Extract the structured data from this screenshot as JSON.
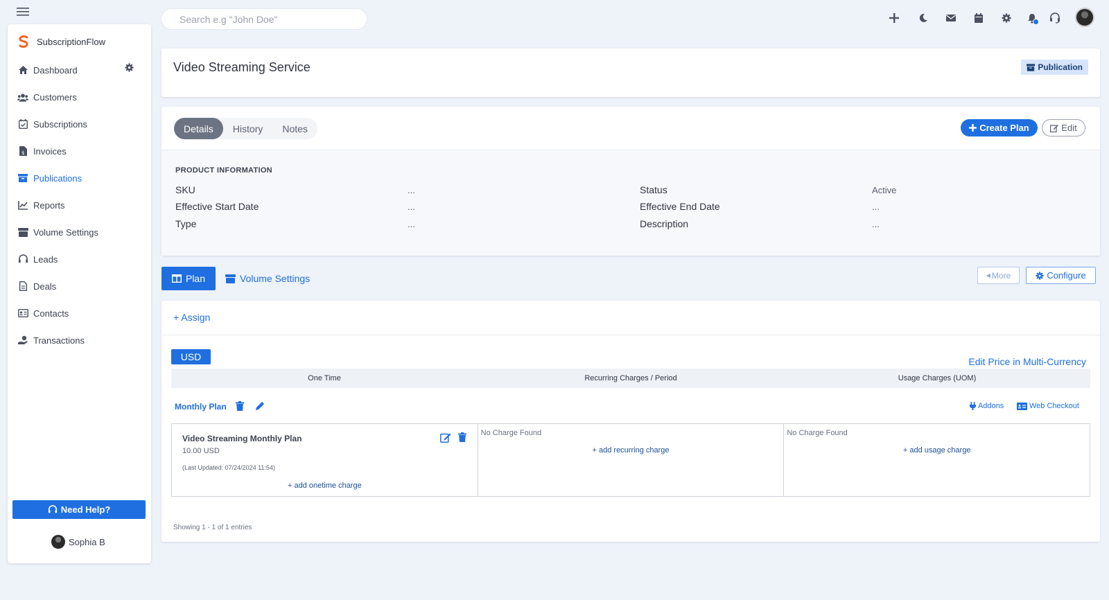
{
  "search": {
    "placeholder": "Search e.g \"John Doe\""
  },
  "brand": {
    "name": "SubscriptionFlow"
  },
  "sidebar": {
    "items": [
      {
        "label": "Dashboard",
        "icon": "home-icon"
      },
      {
        "label": "Customers",
        "icon": "users-icon"
      },
      {
        "label": "Subscriptions",
        "icon": "calendar-check-icon"
      },
      {
        "label": "Invoices",
        "icon": "invoice-icon"
      },
      {
        "label": "Publications",
        "icon": "archive-icon"
      },
      {
        "label": "Reports",
        "icon": "chart-line-icon"
      },
      {
        "label": "Volume Settings",
        "icon": "box-icon"
      },
      {
        "label": "Leads",
        "icon": "headset-icon"
      },
      {
        "label": "Deals",
        "icon": "document-icon"
      },
      {
        "label": "Contacts",
        "icon": "id-card-icon"
      },
      {
        "label": "Transactions",
        "icon": "hand-coin-icon"
      }
    ],
    "active": "Publications",
    "need_help_label": "Need Help?",
    "user_name": "Sophia B"
  },
  "header": {
    "title": "Video Streaming Service",
    "badge": "Publication"
  },
  "details": {
    "tabs": [
      "Details",
      "History",
      "Notes"
    ],
    "active_tab": "Details",
    "create_plan_label": "Create Plan",
    "edit_label": "Edit",
    "section_heading": "PRODUCT INFORMATION",
    "fields": {
      "sku_label": "SKU",
      "sku_value": "...",
      "start_label": "Effective Start Date",
      "start_value": "...",
      "type_label": "Type",
      "type_value": "...",
      "status_label": "Status",
      "status_value": "Active",
      "end_label": "Effective End Date",
      "end_value": "...",
      "description_label": "Description",
      "description_value": "..."
    }
  },
  "plan_tabs": {
    "plan_label": "Plan",
    "volume_label": "Volume Settings",
    "more_label": "More",
    "configure_label": "Configure"
  },
  "plan": {
    "assign_label": "+ Assign",
    "currency": "USD",
    "edit_multi_label": "Edit Price in Multi-Currency",
    "columns": [
      "One Time",
      "Recurring Charges / Period",
      "Usage Charges (UOM)"
    ],
    "plan_name": "Monthly Plan",
    "addons_label": "Addons",
    "web_checkout_label": "Web Checkout",
    "item": {
      "name": "Video Streaming Monthly Plan",
      "price": "10.00 USD",
      "updated": "(Last Updated: 07/24/2024 11:54)",
      "add_onetime": "+ add onetime charge"
    },
    "recurring": {
      "empty": "No Charge Found",
      "add": "+ add recurring charge"
    },
    "usage": {
      "empty": "No Charge Found",
      "add": "+ add usage charge"
    },
    "showing": "Showing 1 - 1 of 1 entries"
  },
  "colors": {
    "accent": "#1f6fe0",
    "background": "#eef2f9",
    "badge_bg": "#d6e5fb",
    "tab_active": "#6c7383"
  }
}
